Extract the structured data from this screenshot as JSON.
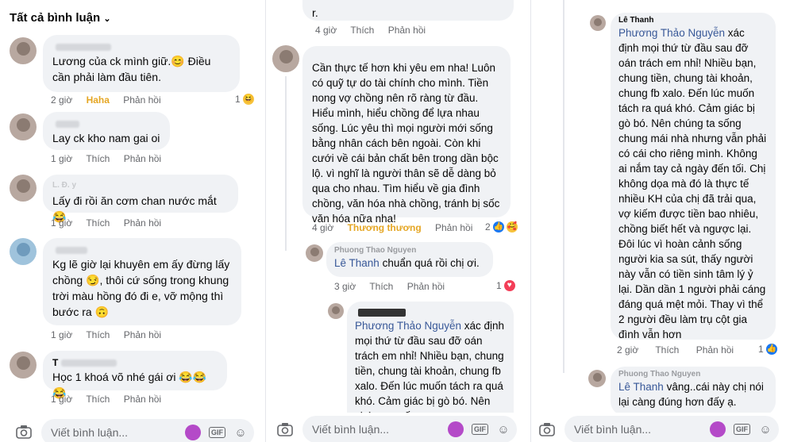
{
  "panel1": {
    "header": "Tất cả bình luận",
    "comments": [
      {
        "text": "Lương của ck mình giữ.😊 Điều cần phải làm đầu tiên.",
        "time": "2 giờ",
        "action": "Haha",
        "reply": "Phản hồi",
        "count": "1"
      },
      {
        "text": "Lay ck kho nam gai oi",
        "time": "1 giờ",
        "action": "Thích",
        "reply": "Phản hồi"
      },
      {
        "name": "L. Đ. y",
        "text": "Lấy đi rồi ăn cơm chan nước mắt 😂",
        "time": "1 giờ",
        "action": "Thích",
        "reply": "Phản hồi"
      },
      {
        "text": "Kg lẽ giờ lại khuyên em ấy đừng lấy chồng 😏, thôi cứ sống trong khung trời màu hồng đó đi e, vỡ mộng thì bước ra 🙃",
        "time": "1 giờ",
        "action": "Thích",
        "reply": "Phản hồi"
      },
      {
        "name": "T",
        "text": "Học 1 khoá võ nhé gái ơi 😂😂😂",
        "time": "1 giờ",
        "action": "Thích",
        "reply": "Phản hồi"
      }
    ],
    "composer": "Viết bình luận..."
  },
  "panel2": {
    "top_text": "r.",
    "top_time": "4 giờ",
    "top_action": "Thích",
    "top_reply": "Phản hồi",
    "main_text": "Cần thực tế hơn khi yêu em nha! Luôn có quỹ tự do tài chính cho mình. Tiền nong vợ chồng nên rõ ràng từ đầu. Hiểu mình, hiểu chồng để lựa nhau sống. Lúc yêu thì mọi người mới sống bằng nhân cách bên ngoài. Còn khi cưới về cái bản chất bên trong dần bộc lộ. vì nghĩ là người thân sẽ dễ dàng bỏ qua cho nhau. Tìm hiểu về gia đình chồng, văn hóa nhà chồng, tránh bị sốc văn hóa nữa nha!",
    "main_time": "4 giờ",
    "main_action": "Thương thương",
    "main_reply": "Phản hồi",
    "main_count": "2",
    "reply1_name": "Phuong Thao Nguyen",
    "reply1_mention": "Lê Thanh",
    "reply1_text": " chuẩn quá rồi chị ơi.",
    "reply1_time": "3 giờ",
    "reply1_action": "Thích",
    "reply1_reply": "Phản hồi",
    "reply1_count": "1",
    "reply2_mention": "Phương Thảo Nguyễn",
    "reply2_text": " xác định mọi thứ từ đầu sau đỡ oán trách em nhỉ! Nhiều bạn, chung tiền, chung tài khoản, chung fb xalo. Đến lúc muốn tách ra quá khó. Cảm giác bị gò bó. Nên chúng ta sống",
    "composer": "Viết bình luận..."
  },
  "panel3": {
    "name": "Lê Thanh",
    "mention": "Phương Thảo Nguyễn",
    "text": " xác định mọi thứ từ đầu sau đỡ oán trách em nhỉ! Nhiều bạn, chung tiền, chung tài khoản, chung fb xalo. Đến lúc muốn tách ra quá khó. Cảm giác bị gò bó. Nên chúng ta sống chung mái nhà nhưng vẫn phải có cái cho riêng mình. Không ai nắm tay cả ngày đến tối. Chị không dọa mà đó là thực tế nhiều KH của chị đã trải qua, vợ kiếm được tiền bao nhiêu, chồng biết hết và ngược lại. Đôi lúc vì hoàn cảnh sống người kia sa sút, thấy người này vẫn có tiền sinh tâm lý ỷ lại. Dần dần 1 người phải cáng đáng quá mệt mỏi. Thay vì thể 2 người đều làm trụ cột gia đình vẫn hơn",
    "time": "2 giờ",
    "action": "Thích",
    "reply": "Phản hồi",
    "count": "1",
    "reply_name": "Phuong Thao Nguyen",
    "reply_mention": "Lê Thanh",
    "reply_text": " vâng..cái này chị nói lại càng đúng hơn đấy ạ.",
    "composer": "Viết bình luận..."
  }
}
